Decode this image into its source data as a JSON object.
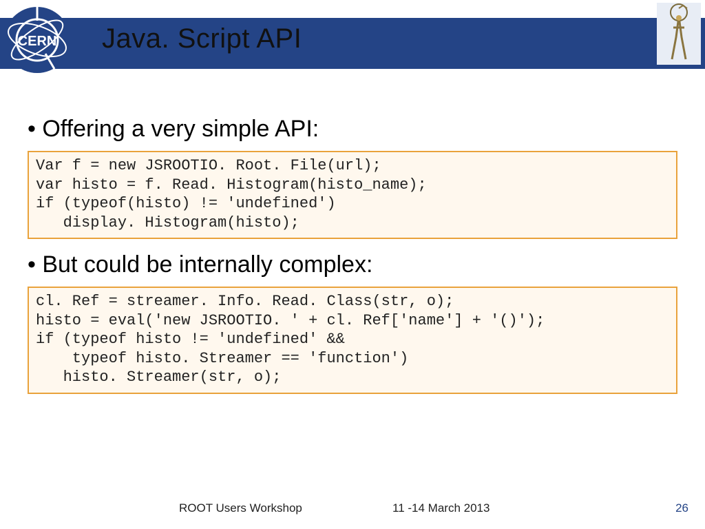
{
  "header": {
    "title": "Java. Script API"
  },
  "body": {
    "bullet1": "Offering a very simple API:",
    "code1": "Var f = new JSROOTIO. Root. File(url);\nvar histo = f. Read. Histogram(histo_name);\nif (typeof(histo) != 'undefined')\n   display. Histogram(histo);",
    "bullet2": "But could be internally complex:",
    "code2": "cl. Ref = streamer. Info. Read. Class(str, o);\nhisto = eval('new JSROOTIO. ' + cl. Ref['name'] + '()');\nif (typeof histo != 'undefined' &&\n    typeof histo. Streamer == 'function')\n   histo. Streamer(str, o);"
  },
  "footer": {
    "venue": "ROOT Users Workshop",
    "date": "11 -14 March 2013",
    "page": "26"
  }
}
